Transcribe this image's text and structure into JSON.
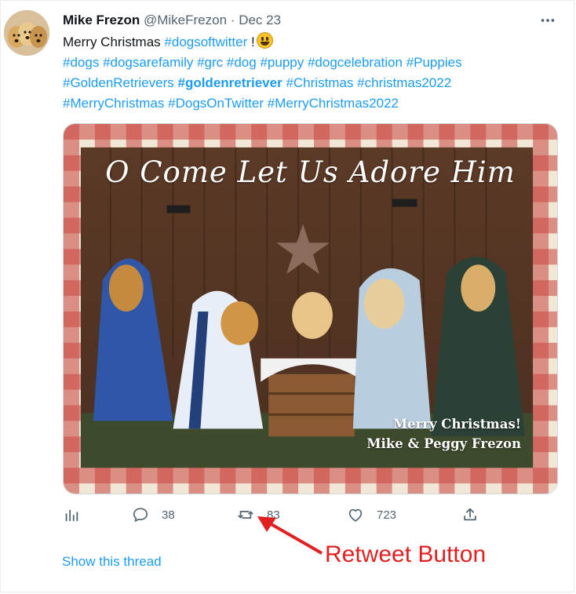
{
  "tweet": {
    "author_name": "Mike Frezon",
    "handle": "@MikeFrezon",
    "separator": "·",
    "date": "Dec 23",
    "text_intro": "Merry Christmas ",
    "tag_dogsoftwitter": "#dogsoftwitter",
    "text_after_tag": " !",
    "hashtags_line2": [
      "#dogs",
      "#dogsarefamily",
      "#grc",
      "#dog",
      "#puppy",
      "#dogcelebration",
      "#Puppies"
    ],
    "hashtags_line3": [
      "#GoldenRetrievers",
      "#goldenretriever",
      "#Christmas",
      "#christmas2022"
    ],
    "hashtags_line4": [
      "#MerryChristmas",
      "#DogsOnTwitter",
      "#MerryChristmas2022"
    ],
    "bold_hashtag": "#goldenretriever"
  },
  "media": {
    "card_title": "O Come Let Us Adore Him",
    "card_message_line1": "Merry Christmas!",
    "card_message_line2": "Mike & Peggy Frezon"
  },
  "actions": {
    "analytics_icon": "analytics-icon",
    "reply_icon": "reply-icon",
    "reply_count": "38",
    "retweet_icon": "retweet-icon",
    "retweet_count": "83",
    "like_icon": "like-icon",
    "like_count": "723",
    "share_icon": "share-icon"
  },
  "annotation": {
    "label": "Retweet Button",
    "color": "#e02020"
  },
  "show_thread": "Show this thread",
  "colors": {
    "link": "#1d9bf0",
    "muted": "#536471",
    "text": "#0f1419"
  }
}
